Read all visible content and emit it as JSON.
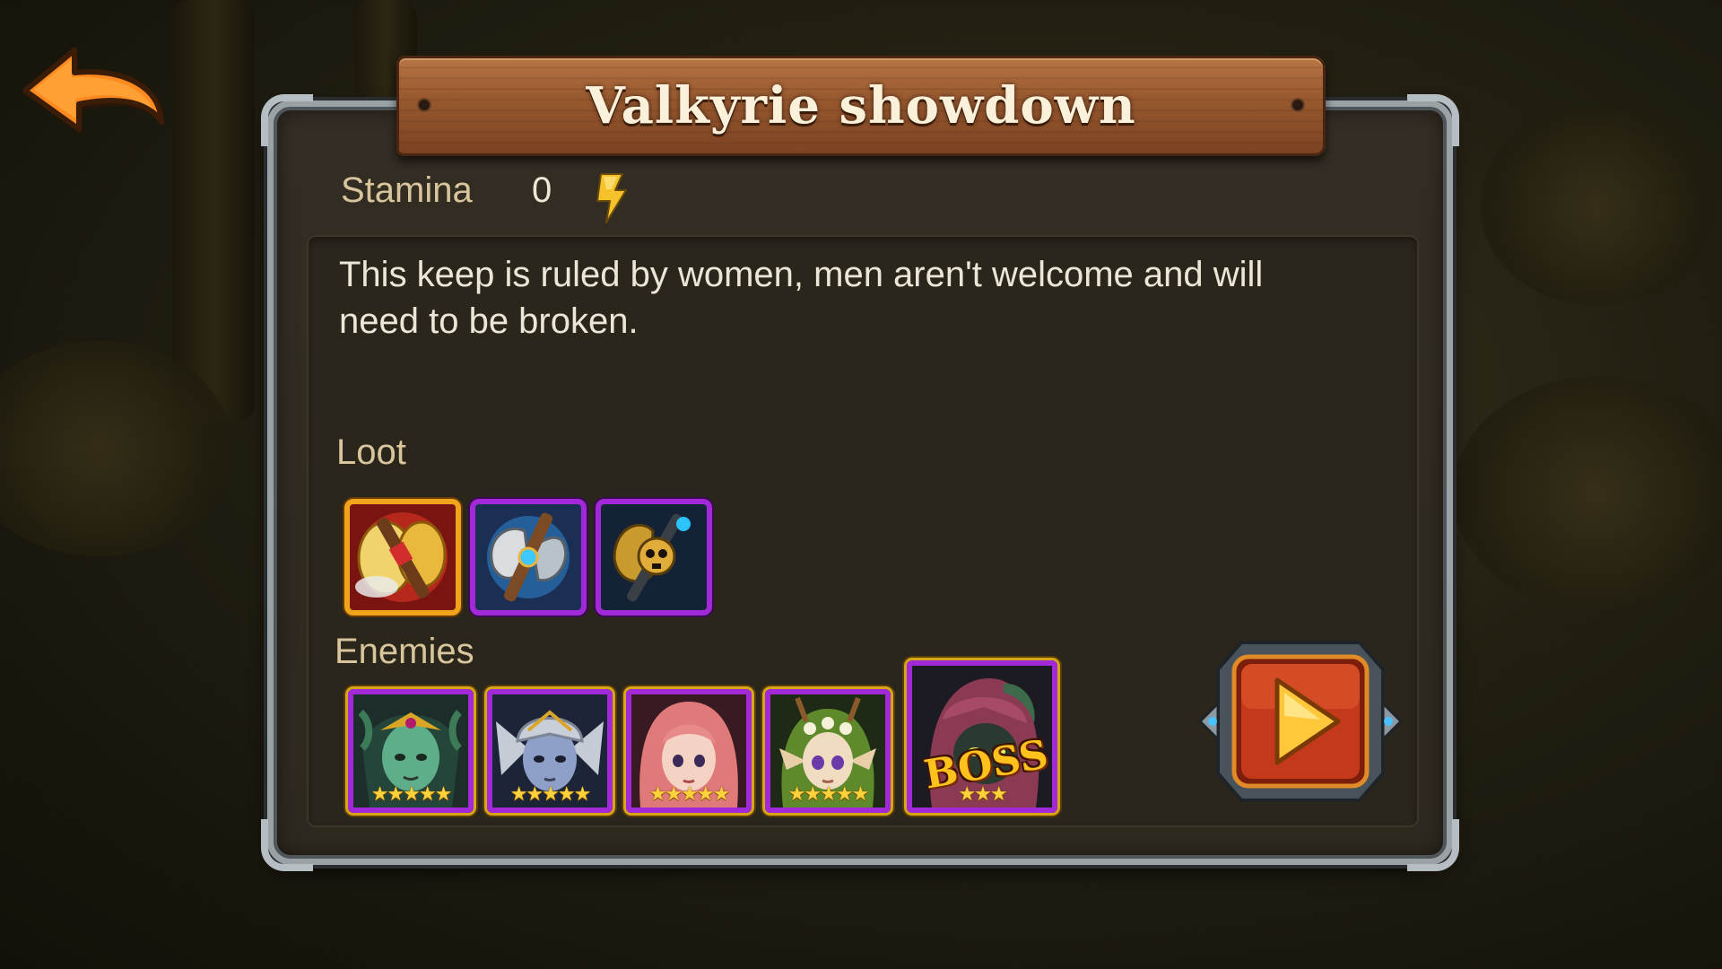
{
  "background": {
    "tone": "#221f12"
  },
  "back_button": {
    "icon": "back-arrow-icon",
    "color": "#f0801e"
  },
  "dialog": {
    "title": "Valkyrie showdown",
    "stamina": {
      "label": "Stamina",
      "value": "0",
      "icon": "lightning-bolt-icon"
    },
    "description": "This keep is ruled by women, men aren't welcome and will need to be broken.",
    "loot": {
      "label": "Loot",
      "items": [
        {
          "name": "golden-axe-icon",
          "rarity": "gold"
        },
        {
          "name": "battle-axe-icon",
          "rarity": "purple"
        },
        {
          "name": "skull-axe-icon",
          "rarity": "purple"
        }
      ]
    },
    "enemies": {
      "label": "Enemies",
      "list": [
        {
          "portrait": "medusa-portrait-icon",
          "stars": "★★★★★"
        },
        {
          "portrait": "valkyrie-portrait-icon",
          "stars": "★★★★★"
        },
        {
          "portrait": "red-haired-girl-portrait-icon",
          "stars": "★★★★★"
        },
        {
          "portrait": "forest-elf-portrait-icon",
          "stars": "★★★★★"
        },
        {
          "portrait": "hooded-boss-portrait-icon",
          "stars": "★★★",
          "badge": "BOSS"
        }
      ]
    },
    "start_button": {
      "icon": "play-icon",
      "color": "#c4381c"
    }
  }
}
